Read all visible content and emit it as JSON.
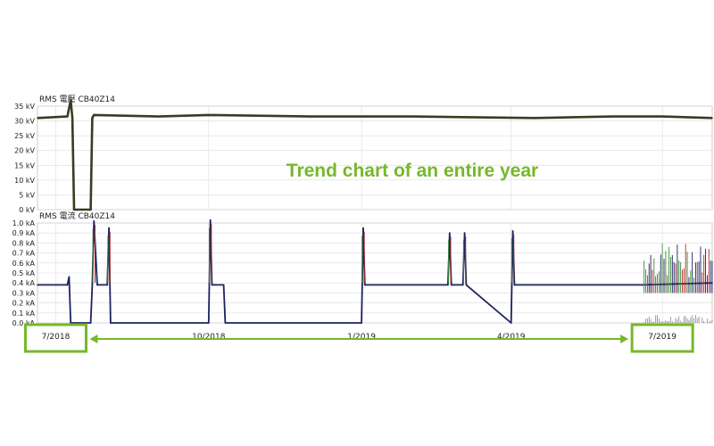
{
  "colors": {
    "voltage_line": "#3b3b24",
    "current_main": "#1c2260",
    "current_red": "#b22a2a",
    "current_green": "#3a8a3a",
    "current_gray": "#8a8a8a",
    "grid": "#dcdcdc",
    "axis": "#a0a0a0",
    "accent": "#76b82a"
  },
  "annotation": {
    "text": "Trend chart of an entire year"
  },
  "x_axis": {
    "labels": [
      "7/2018",
      "10/2018",
      "1/2019",
      "4/2019",
      "7/2019"
    ],
    "range_arrow": {
      "from": "7/2018",
      "to": "7/2019"
    }
  },
  "chart_data": [
    {
      "type": "line",
      "title": "RMS 電壓 CB40Z14",
      "unit": "kV",
      "x_range": [
        "2018-06-20",
        "2019-07-31"
      ],
      "ylim": [
        0,
        35
      ],
      "yticks": [
        "0 kV",
        "5 kV",
        "10 kV",
        "15 kV",
        "20 kV",
        "25 kV",
        "30 kV",
        "35 kV"
      ],
      "grid": true,
      "series": [
        {
          "x": [
            "2018-06-20",
            "2018-07-08",
            "2018-07-10",
            "2018-07-11",
            "2018-07-12",
            "2018-07-22",
            "2018-07-23",
            "2018-07-24",
            "2018-09-01",
            "2018-10-01",
            "2018-12-01",
            "2019-02-01",
            "2019-04-15",
            "2019-06-01",
            "2019-07-01",
            "2019-07-31"
          ],
          "y": [
            31,
            31.5,
            37,
            31,
            0,
            0,
            31,
            32,
            31.5,
            32,
            31.5,
            31.5,
            31,
            31.5,
            31.5,
            31
          ]
        }
      ]
    },
    {
      "type": "line",
      "title": "RMS 電流 CB40Z14",
      "unit": "kA",
      "x_range": [
        "2018-06-20",
        "2019-07-31"
      ],
      "ylim": [
        0,
        1.0
      ],
      "yticks": [
        "0.0 kA",
        "0.1 kA",
        "0.2 kA",
        "0.3 kA",
        "0.4 kA",
        "0.5 kA",
        "0.6 kA",
        "0.7 kA",
        "0.8 kA",
        "0.9 kA",
        "1.0 kA"
      ],
      "grid": true,
      "series": [
        {
          "x": [
            "2018-06-20",
            "2018-07-08",
            "2018-07-09",
            "2018-07-10",
            "2018-07-22",
            "2018-07-23",
            "2018-07-24",
            "2018-07-26",
            "2018-08-01",
            "2018-08-02",
            "2018-08-03",
            "2018-10-01",
            "2018-10-02",
            "2018-10-03",
            "2018-10-10",
            "2018-10-11",
            "2019-01-01",
            "2019-01-02",
            "2019-01-03",
            "2019-02-22",
            "2019-02-23",
            "2019-02-24",
            "2019-03-03",
            "2019-03-04",
            "2019-03-05",
            "2019-04-01",
            "2019-04-02",
            "2019-04-03",
            "2019-06-20",
            "2019-07-31"
          ],
          "y": [
            0.38,
            0.38,
            0.46,
            0,
            0,
            0.38,
            1.02,
            0.38,
            0.38,
            0.95,
            0,
            0,
            1.03,
            0.38,
            0.38,
            0,
            0,
            0.95,
            0.38,
            0.38,
            0.9,
            0.38,
            0.38,
            0.9,
            0.38,
            0,
            0.92,
            0.38,
            0.38,
            0.4
          ]
        }
      ]
    }
  ]
}
